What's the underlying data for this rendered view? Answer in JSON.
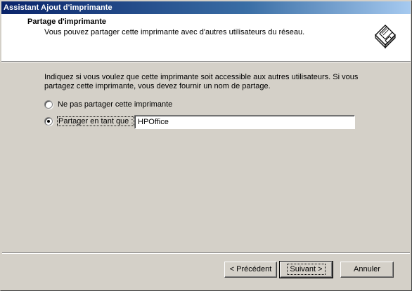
{
  "window": {
    "title": "Assistant Ajout d'imprimante"
  },
  "header": {
    "title": "Partage d'imprimante",
    "subtitle": "Vous pouvez partager cette imprimante avec d'autres utilisateurs du réseau.",
    "icon": "printer-icon"
  },
  "body": {
    "description": "Indiquez si vous voulez que cette imprimante soit accessible aux autres utilisateurs. Si vous partagez cette imprimante, vous devez fournir un nom de partage.",
    "options": [
      {
        "label": "Ne pas partager cette imprimante",
        "checked": false
      },
      {
        "label": "Partager en tant que :",
        "checked": true
      }
    ],
    "share_name": "HPOffice"
  },
  "footer": {
    "back_label": "< Précédent",
    "next_label": "Suivant >",
    "cancel_label": "Annuler"
  }
}
